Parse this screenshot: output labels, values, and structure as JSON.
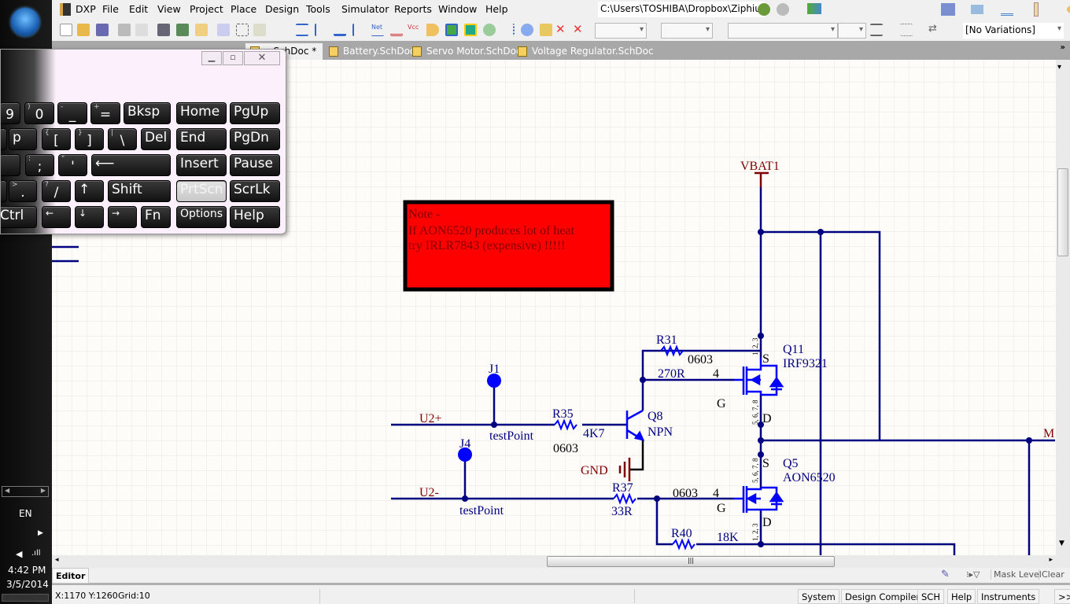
{
  "taskbar": {
    "language": "EN",
    "time": "4:42 PM",
    "date": "3/5/2014"
  },
  "menubar": {
    "app": "DXP",
    "items": [
      "File",
      "Edit",
      "View",
      "Project",
      "Place",
      "Design",
      "Tools",
      "Simulator",
      "Reports",
      "Window",
      "Help"
    ],
    "path": "C:\\Users\\TOSHIBA\\Dropbox\\Ziphiu"
  },
  "toolbar": {
    "variations": "[No Variations]",
    "icons": [
      "new-doc",
      "open",
      "save",
      "print",
      "print-preview",
      "layers",
      "board",
      "sheet",
      "zoom-fit",
      "zoom-area",
      "zoom-selected",
      "bus",
      "bus-entry",
      "wire-bus",
      "wire",
      "net-label",
      "gnd-port",
      "vcc-port",
      "part",
      "sheet-symbol",
      "sheet-entry",
      "refresh",
      "port",
      "port-entry",
      "directive",
      "no-erc",
      "no-erc-cross"
    ]
  },
  "tabs": [
    {
      "label": "...SchDoc *",
      "active": true
    },
    {
      "label": "Battery.SchDoc"
    },
    {
      "label": "Servo Motor.SchDoc"
    },
    {
      "label": "Voltage Regulator.SchDoc"
    }
  ],
  "keyboard": {
    "keys": {
      "k9": "9",
      "k0": "0",
      "k0s": ")",
      "minus": "-",
      "minuss": "_",
      "eq": "=",
      "eqs": "+",
      "bksp": "Bksp",
      "home": "Home",
      "pgup": "PgUp",
      "p": "p",
      "lb": "[",
      "lbs": "{",
      "rb": "]",
      "rbs": "}",
      "bs": "\\",
      "bss": "|",
      "del": "Del",
      "end": "End",
      "pgdn": "PgDn",
      "semi": ";",
      "semis": ":",
      "quote": "'",
      "quotes": "\"",
      "enter": "⟵",
      "insert": "Insert",
      "pause": "Pause",
      "dot": ".",
      "dots": ">",
      "slash": "/",
      "slashs": "?",
      "up": "↑",
      "shift": "Shift",
      "prtscn": "PrtScn",
      "scrlk": "ScrLk",
      "ctrl": "Ctrl",
      "left": "←",
      "down": "↓",
      "right": "→",
      "fn": "Fn",
      "options": "Options",
      "help": "Help"
    }
  },
  "schematic": {
    "note": [
      "Note -",
      "If AON6520 produces lot of heat",
      "try IRLR7843 (expensive) !!!!!"
    ],
    "note_color": "#ff0000",
    "vbat": "VBAT1",
    "gnd": "GND",
    "u2p": "U2+",
    "u2m": "U2-",
    "m": "M",
    "j1": "J1",
    "j4": "J4",
    "tp1": "testPoint",
    "tp2": "testPoint",
    "r31": "R31",
    "r31_fp": "0603",
    "r31_val": "270R",
    "r35": "R35",
    "r35_val": "4K7",
    "r35_fp": "0603",
    "r37": "R37",
    "r37_val": "33R",
    "r37_fp": "0603",
    "r40": "R40",
    "r40_val": "18K",
    "q8": "Q8",
    "q8_type": "NPN",
    "q11": "Q11",
    "q11_part": "IRF9321",
    "q5": "Q5",
    "q5_part": "AON6520",
    "pin_s": "S",
    "pin_g": "G",
    "pin_d": "D",
    "pin4": "4",
    "pins123": "1, 2, 3",
    "pins5678": "5, 6, 7, 8",
    "wire_color": "#000080",
    "power_color": "#800000"
  },
  "panel": {
    "editor": "Editor",
    "mask_level": "Mask Level",
    "clear": "Clear"
  },
  "status": {
    "coords": "X:1170 Y:1260",
    "grid": "Grid:10",
    "buttons": [
      "System",
      "Design Compiler",
      "SCH",
      "Help",
      "Instruments"
    ],
    "more": ">>"
  }
}
